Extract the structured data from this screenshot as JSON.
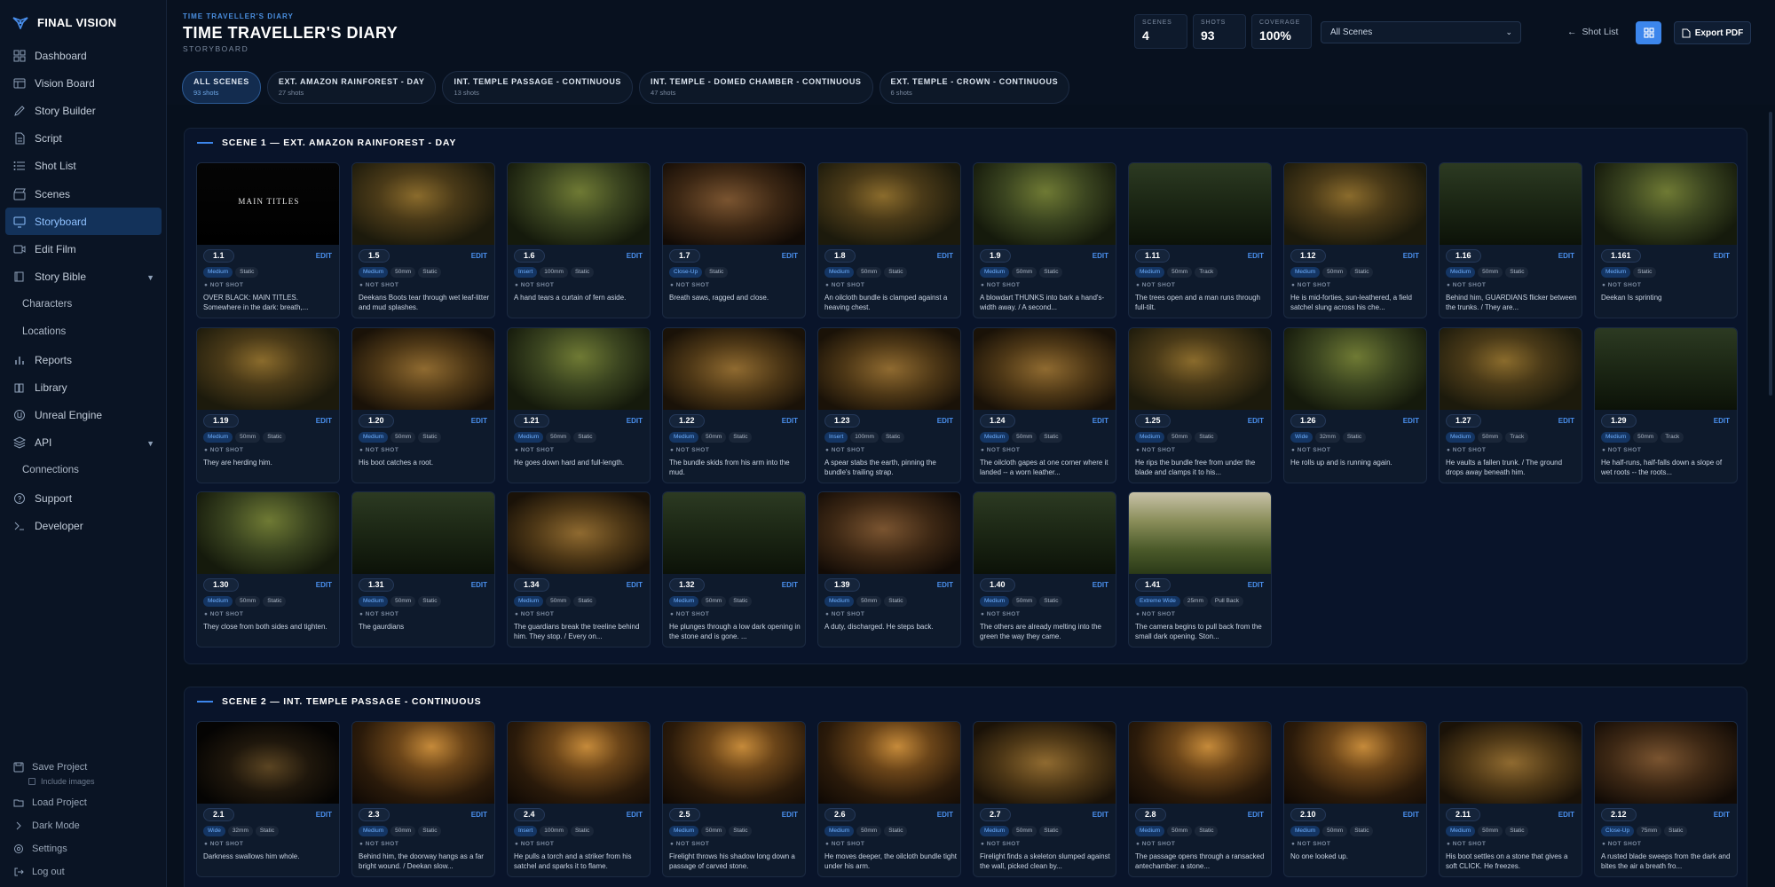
{
  "app": {
    "name": "FINAL VISION"
  },
  "sidebar": {
    "items": [
      {
        "label": "Dashboard",
        "icon": "dashboard-icon"
      },
      {
        "label": "Vision Board",
        "icon": "board-icon"
      },
      {
        "label": "Story Builder",
        "icon": "pen-icon"
      },
      {
        "label": "Script",
        "icon": "document-icon"
      },
      {
        "label": "Shot List",
        "icon": "list-icon"
      },
      {
        "label": "Scenes",
        "icon": "clapper-icon"
      },
      {
        "label": "Storyboard",
        "icon": "monitor-icon",
        "active": true
      },
      {
        "label": "Edit Film",
        "icon": "video-icon"
      },
      {
        "label": "Story Bible",
        "icon": "book-icon",
        "expandable": true
      },
      {
        "label": "Characters",
        "sub": true
      },
      {
        "label": "Locations",
        "sub": true
      },
      {
        "label": "Reports",
        "icon": "bar-chart-icon"
      },
      {
        "label": "Library",
        "icon": "library-icon"
      },
      {
        "label": "Unreal Engine",
        "icon": "engine-icon"
      },
      {
        "label": "API",
        "icon": "layers-icon",
        "expandable": true
      },
      {
        "label": "Connections",
        "sub": true
      },
      {
        "label": "Support",
        "icon": "help-icon"
      },
      {
        "label": "Developer",
        "icon": "terminal-icon"
      }
    ],
    "bottom": {
      "save_project": "Save Project",
      "include_images": "Include images",
      "load_project": "Load Project",
      "dark_mode": "Dark Mode",
      "settings": "Settings",
      "log_out": "Log out"
    }
  },
  "header": {
    "eyebrow": "TIME TRAVELLER'S DIARY",
    "title": "TIME TRAVELLER'S DIARY",
    "subtitle": "STORYBOARD",
    "stats": [
      {
        "label": "SCENES",
        "value": "4"
      },
      {
        "label": "SHOTS",
        "value": "93"
      },
      {
        "label": "COVERAGE",
        "value": "100%"
      }
    ],
    "scene_select": "All Scenes",
    "shot_list_link": "Shot List",
    "export_label": "Export PDF"
  },
  "filters": [
    {
      "label": "ALL SCENES",
      "count": "93 shots",
      "active": true
    },
    {
      "label": "EXT. AMAZON RAINFOREST - DAY",
      "count": "27 shots"
    },
    {
      "label": "INT. TEMPLE PASSAGE - CONTINUOUS",
      "count": "13 shots"
    },
    {
      "label": "INT. TEMPLE - DOMED CHAMBER - CONTINUOUS",
      "count": "47 shots"
    },
    {
      "label": "EXT. TEMPLE - CROWN - CONTINUOUS",
      "count": "6 shots"
    }
  ],
  "colors": {
    "accent": "#3c86ec",
    "shot_type_tag": "#6fb0ff",
    "background": "#07101d"
  },
  "edit_label": "EDIT",
  "scenes": [
    {
      "title": "SCENE 1 — EXT. AMAZON RAINFOREST - DAY",
      "shots": [
        {
          "id": "1.1",
          "tags": [
            "Medium",
            "Static"
          ],
          "status": "NOT SHOT",
          "desc": "OVER BLACK: MAIN TITLES. Somewhere in the dark: breath,...",
          "thumb_text": "MAIN TITLES",
          "tone": "black"
        },
        {
          "id": "1.5",
          "tags": [
            "Medium",
            "50mm",
            "Static"
          ],
          "status": "NOT SHOT",
          "desc": "Deekans Boots tear through wet leaf-litter and mud splashes.",
          "tone": "jungle"
        },
        {
          "id": "1.6",
          "tags": [
            "Insert",
            "100mm",
            "Static"
          ],
          "status": "NOT SHOT",
          "desc": "A hand tears a curtain of fern aside.",
          "tone": "green"
        },
        {
          "id": "1.7",
          "tags": [
            "Close-Up",
            "Static"
          ],
          "status": "NOT SHOT",
          "desc": "Breath saws, ragged and close.",
          "tone": "face"
        },
        {
          "id": "1.8",
          "tags": [
            "Medium",
            "50mm",
            "Static"
          ],
          "status": "NOT SHOT",
          "desc": "An oilcloth bundle is clamped against a heaving chest.",
          "tone": "jungle"
        },
        {
          "id": "1.9",
          "tags": [
            "Medium",
            "50mm",
            "Static"
          ],
          "status": "NOT SHOT",
          "desc": "A blowdart THUNKS into bark a hand's-width away. / A second...",
          "tone": "green"
        },
        {
          "id": "1.11",
          "tags": [
            "Medium",
            "50mm",
            "Track"
          ],
          "status": "NOT SHOT",
          "desc": "The trees open and a man runs through full-tilt.",
          "tone": "forest"
        },
        {
          "id": "1.12",
          "tags": [
            "Medium",
            "50mm",
            "Static"
          ],
          "status": "NOT SHOT",
          "desc": "He is mid-forties, sun-leathered, a field satchel slung across his che...",
          "tone": "jungle"
        },
        {
          "id": "1.16",
          "tags": [
            "Medium",
            "50mm",
            "Static"
          ],
          "status": "NOT SHOT",
          "desc": "Behind him, GUARDIANS flicker between the trunks. / They are...",
          "tone": "forest"
        },
        {
          "id": "1.161",
          "tags": [
            "Medium",
            "Static"
          ],
          "status": "NOT SHOT",
          "desc": "Deekan Is sprinting",
          "tone": "green"
        },
        {
          "id": "1.19",
          "tags": [
            "Medium",
            "50mm",
            "Static"
          ],
          "status": "NOT SHOT",
          "desc": "They are herding him.",
          "tone": "jungle"
        },
        {
          "id": "1.20",
          "tags": [
            "Medium",
            "50mm",
            "Static"
          ],
          "status": "NOT SHOT",
          "desc": "His boot catches a root.",
          "tone": "amber"
        },
        {
          "id": "1.21",
          "tags": [
            "Medium",
            "50mm",
            "Static"
          ],
          "status": "NOT SHOT",
          "desc": "He goes down hard and full-length.",
          "tone": "green"
        },
        {
          "id": "1.22",
          "tags": [
            "Medium",
            "50mm",
            "Static"
          ],
          "status": "NOT SHOT",
          "desc": "The bundle skids from his arm into the mud.",
          "tone": "amber"
        },
        {
          "id": "1.23",
          "tags": [
            "Insert",
            "100mm",
            "Static"
          ],
          "status": "NOT SHOT",
          "desc": "A spear stabs the earth, pinning the bundle's trailing strap.",
          "tone": "amber"
        },
        {
          "id": "1.24",
          "tags": [
            "Medium",
            "50mm",
            "Static"
          ],
          "status": "NOT SHOT",
          "desc": "The oilcloth gapes at one corner where it landed -- a worn leather...",
          "tone": "amber"
        },
        {
          "id": "1.25",
          "tags": [
            "Medium",
            "50mm",
            "Static"
          ],
          "status": "NOT SHOT",
          "desc": "He rips the bundle free from under the blade and clamps it to his...",
          "tone": "jungle"
        },
        {
          "id": "1.26",
          "tags": [
            "Wide",
            "32mm",
            "Static"
          ],
          "status": "NOT SHOT",
          "desc": "He rolls up and is running again.",
          "tone": "green"
        },
        {
          "id": "1.27",
          "tags": [
            "Medium",
            "50mm",
            "Track"
          ],
          "status": "NOT SHOT",
          "desc": "He vaults a fallen trunk. / The ground drops away beneath him.",
          "tone": "jungle"
        },
        {
          "id": "1.29",
          "tags": [
            "Medium",
            "50mm",
            "Track"
          ],
          "status": "NOT SHOT",
          "desc": "He half-runs, half-falls down a slope of wet roots -- the roots...",
          "tone": "forest"
        },
        {
          "id": "1.30",
          "tags": [
            "Medium",
            "50mm",
            "Static"
          ],
          "status": "NOT SHOT",
          "desc": "They close from both sides and tighten.",
          "tone": "green"
        },
        {
          "id": "1.31",
          "tags": [
            "Medium",
            "50mm",
            "Static"
          ],
          "status": "NOT SHOT",
          "desc": "The gaurdians",
          "tone": "forest"
        },
        {
          "id": "1.34",
          "tags": [
            "Medium",
            "50mm",
            "Static"
          ],
          "status": "NOT SHOT",
          "desc": "The guardians break the treeline behind him. They stop. / Every on...",
          "tone": "amber"
        },
        {
          "id": "1.32",
          "tags": [
            "Medium",
            "50mm",
            "Static"
          ],
          "status": "NOT SHOT",
          "desc": "He plunges through a low dark opening in the stone and is gone. ...",
          "tone": "forest"
        },
        {
          "id": "1.39",
          "tags": [
            "Medium",
            "50mm",
            "Static"
          ],
          "status": "NOT SHOT",
          "desc": "A duty, discharged. He steps back.",
          "tone": "face"
        },
        {
          "id": "1.40",
          "tags": [
            "Medium",
            "50mm",
            "Static"
          ],
          "status": "NOT SHOT",
          "desc": "The others are already melting into the green the way they came.",
          "tone": "forest"
        },
        {
          "id": "1.41",
          "tags": [
            "Extreme Wide",
            "25mm",
            "Pull Back"
          ],
          "status": "NOT SHOT",
          "desc": "The camera begins to pull back from the small dark opening. Ston...",
          "tone": "sky"
        }
      ]
    },
    {
      "title": "SCENE 2 — INT. TEMPLE PASSAGE - CONTINUOUS",
      "shots": [
        {
          "id": "2.1",
          "tags": [
            "Wide",
            "32mm",
            "Static"
          ],
          "status": "NOT SHOT",
          "desc": "Darkness swallows him whole.",
          "tone": "dark"
        },
        {
          "id": "2.3",
          "tags": [
            "Medium",
            "50mm",
            "Static"
          ],
          "status": "NOT SHOT",
          "desc": "Behind him, the doorway hangs as a far bright wound. / Deekan slow...",
          "tone": "torch"
        },
        {
          "id": "2.4",
          "tags": [
            "Insert",
            "100mm",
            "Static"
          ],
          "status": "NOT SHOT",
          "desc": "He pulls a torch and a striker from his satchel and sparks it to flame.",
          "tone": "torch"
        },
        {
          "id": "2.5",
          "tags": [
            "Medium",
            "50mm",
            "Static"
          ],
          "status": "NOT SHOT",
          "desc": "Firelight throws his shadow long down a passage of carved stone.",
          "tone": "torch"
        },
        {
          "id": "2.6",
          "tags": [
            "Medium",
            "50mm",
            "Static"
          ],
          "status": "NOT SHOT",
          "desc": "He moves deeper, the oilcloth bundle tight under his arm.",
          "tone": "torch"
        },
        {
          "id": "2.7",
          "tags": [
            "Medium",
            "50mm",
            "Static"
          ],
          "status": "NOT SHOT",
          "desc": "Firelight finds a skeleton slumped against the wall, picked clean by...",
          "tone": "amber"
        },
        {
          "id": "2.8",
          "tags": [
            "Medium",
            "50mm",
            "Static"
          ],
          "status": "NOT SHOT",
          "desc": "The passage opens through a ransacked antechamber: a stone...",
          "tone": "torch"
        },
        {
          "id": "2.10",
          "tags": [
            "Medium",
            "50mm",
            "Static"
          ],
          "status": "NOT SHOT",
          "desc": "No one looked up.",
          "tone": "torch"
        },
        {
          "id": "2.11",
          "tags": [
            "Medium",
            "50mm",
            "Static"
          ],
          "status": "NOT SHOT",
          "desc": "His boot settles on a stone that gives a soft CLICK. He freezes.",
          "tone": "amber"
        },
        {
          "id": "2.12",
          "tags": [
            "Close-Up",
            "75mm",
            "Static"
          ],
          "status": "NOT SHOT",
          "desc": "A rusted blade sweeps from the dark and bites the air a breath fro...",
          "tone": "face"
        }
      ]
    }
  ]
}
